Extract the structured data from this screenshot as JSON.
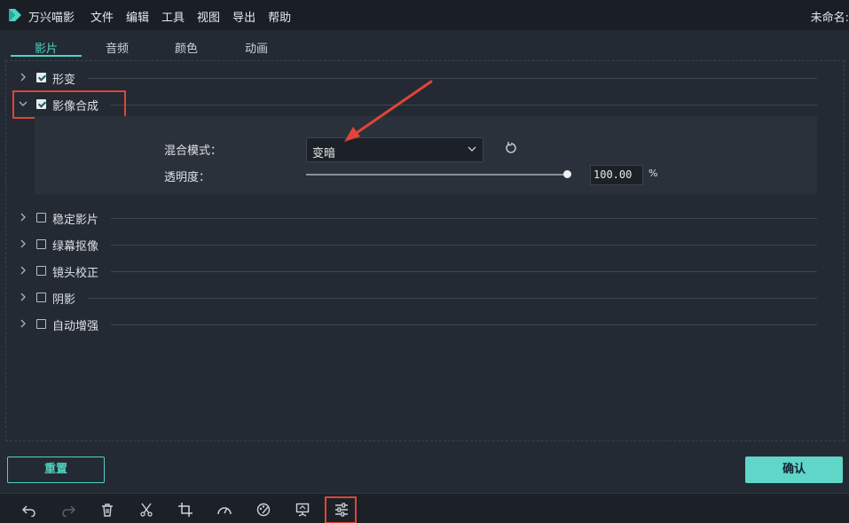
{
  "app": {
    "name": "万兴喵影",
    "doc_title": "未命名:"
  },
  "menu": [
    "文件",
    "编辑",
    "工具",
    "视图",
    "导出",
    "帮助"
  ],
  "tabs": [
    "影片",
    "音频",
    "颜色",
    "动画"
  ],
  "sections": [
    {
      "label": "形变",
      "checked": true,
      "expanded": false
    },
    {
      "label": "影像合成",
      "checked": true,
      "expanded": true
    },
    {
      "label": "稳定影片",
      "checked": false,
      "expanded": false
    },
    {
      "label": "绿幕抠像",
      "checked": false,
      "expanded": false
    },
    {
      "label": "镜头校正",
      "checked": false,
      "expanded": false
    },
    {
      "label": "阴影",
      "checked": false,
      "expanded": false
    },
    {
      "label": "自动增强",
      "checked": false,
      "expanded": false
    }
  ],
  "compose": {
    "blend_label": "混合模式：",
    "blend_value": "变暗",
    "opacity_label": "透明度：",
    "opacity_value": "100.00",
    "opacity_unit": "%",
    "opacity_fraction": 1.0
  },
  "buttons": {
    "reset": "重置",
    "ok": "确认"
  },
  "colors": {
    "accent": "#4fd3c4",
    "highlight": "#e0443a",
    "background": "#232a33"
  }
}
